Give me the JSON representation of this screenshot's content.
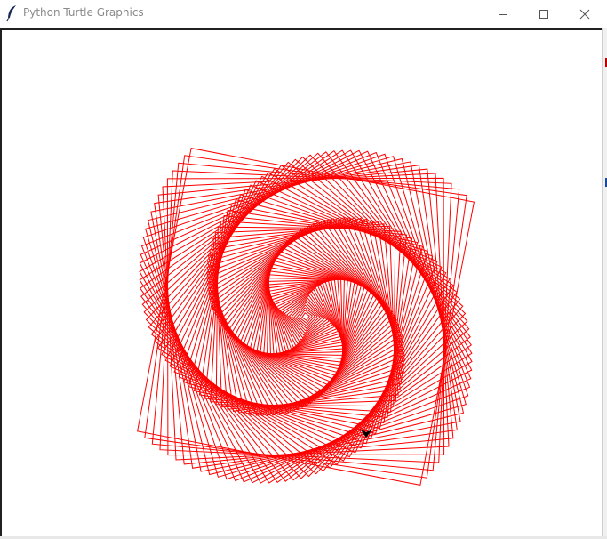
{
  "window": {
    "title": "Python Turtle Graphics"
  },
  "icons": {
    "app": "feather-icon",
    "minimize": "minimize-icon",
    "maximize": "maximize-icon",
    "close": "close-icon",
    "turtle": "turtle-cursor-icon"
  },
  "drawing": {
    "pen_color": "#ff0000",
    "turtle_color": "#000000",
    "background": "#ffffff"
  }
}
